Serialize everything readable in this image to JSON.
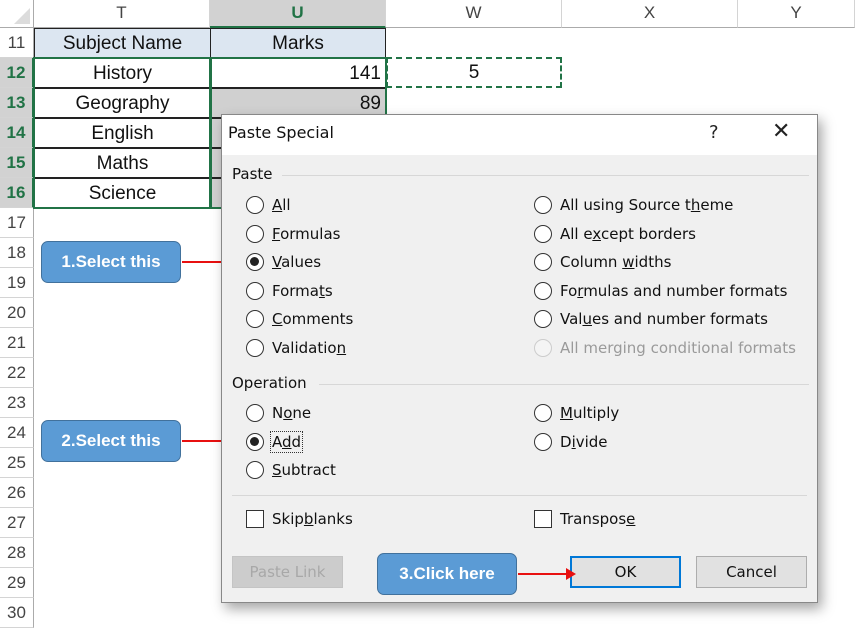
{
  "spreadsheet": {
    "columns": [
      "T",
      "U",
      "W",
      "X",
      "Y"
    ],
    "selected_column": "U",
    "rows": [
      "11",
      "12",
      "13",
      "14",
      "15",
      "16",
      "17",
      "18",
      "19",
      "20",
      "21",
      "22",
      "23",
      "24",
      "25",
      "26",
      "27",
      "28",
      "29",
      "30"
    ],
    "table_headers": {
      "subject": "Subject Name",
      "marks": "Marks"
    },
    "table_rows": [
      {
        "row": "12",
        "subject": "History",
        "marks": "141"
      },
      {
        "row": "13",
        "subject": "Geography",
        "marks": "89"
      },
      {
        "row": "14",
        "subject": "English",
        "marks": ""
      },
      {
        "row": "15",
        "subject": "Maths",
        "marks": ""
      },
      {
        "row": "16",
        "subject": "Science",
        "marks": ""
      }
    ],
    "copied_cell_value": "5"
  },
  "dialog": {
    "title": "Paste Special",
    "help_label": "?",
    "close_label": "✕",
    "paste_group_label": "Paste",
    "paste_options_left": [
      {
        "pre": "",
        "key": "A",
        "post": "ll",
        "checked": false
      },
      {
        "pre": "",
        "key": "F",
        "post": "ormulas",
        "checked": false
      },
      {
        "pre": "",
        "key": "V",
        "post": "alues",
        "checked": true
      },
      {
        "pre": "Forma",
        "key": "t",
        "post": "s",
        "checked": false
      },
      {
        "pre": "",
        "key": "C",
        "post": "omments",
        "checked": false
      },
      {
        "pre": "Validatio",
        "key": "n",
        "post": "",
        "checked": false
      }
    ],
    "paste_options_right": [
      {
        "pre": "All using Source t",
        "key": "h",
        "post": "eme",
        "checked": false,
        "disabled": false
      },
      {
        "pre": "All e",
        "key": "x",
        "post": "cept borders",
        "checked": false,
        "disabled": false
      },
      {
        "pre": "Column ",
        "key": "w",
        "post": "idths",
        "checked": false,
        "disabled": false
      },
      {
        "pre": "Fo",
        "key": "r",
        "post": "mulas and number formats",
        "checked": false,
        "disabled": false
      },
      {
        "pre": "Val",
        "key": "u",
        "post": "es and number formats",
        "checked": false,
        "disabled": false
      },
      {
        "pre": "All merging conditional formats",
        "key": "",
        "post": "",
        "checked": false,
        "disabled": true
      }
    ],
    "operation_group_label": "Operation",
    "operation_options_left": [
      {
        "pre": "N",
        "key": "o",
        "post": "ne",
        "checked": false
      },
      {
        "pre": "A",
        "key": "d",
        "post": "d",
        "checked": true
      },
      {
        "pre": "",
        "key": "S",
        "post": "ubtract",
        "checked": false
      }
    ],
    "operation_options_right": [
      {
        "pre": "",
        "key": "M",
        "post": "ultiply",
        "checked": false
      },
      {
        "pre": "D",
        "key": "i",
        "post": "vide",
        "checked": false
      }
    ],
    "skip_blanks": {
      "pre": "Skip ",
      "key": "b",
      "post": "lanks",
      "checked": false
    },
    "transpose": {
      "pre": "Transpos",
      "key": "e",
      "post": "",
      "checked": false
    },
    "buttons": {
      "paste_link": "Paste Link",
      "ok": "OK",
      "cancel": "Cancel"
    }
  },
  "annotations": {
    "step1": "1.Select this",
    "step2": "2.Select this",
    "step3": "3.Click here"
  },
  "colors": {
    "excel_green": "#217346",
    "callout_blue": "#5b9bd5",
    "arrow_red": "#e81010",
    "ok_focus_blue": "#0078d7"
  }
}
